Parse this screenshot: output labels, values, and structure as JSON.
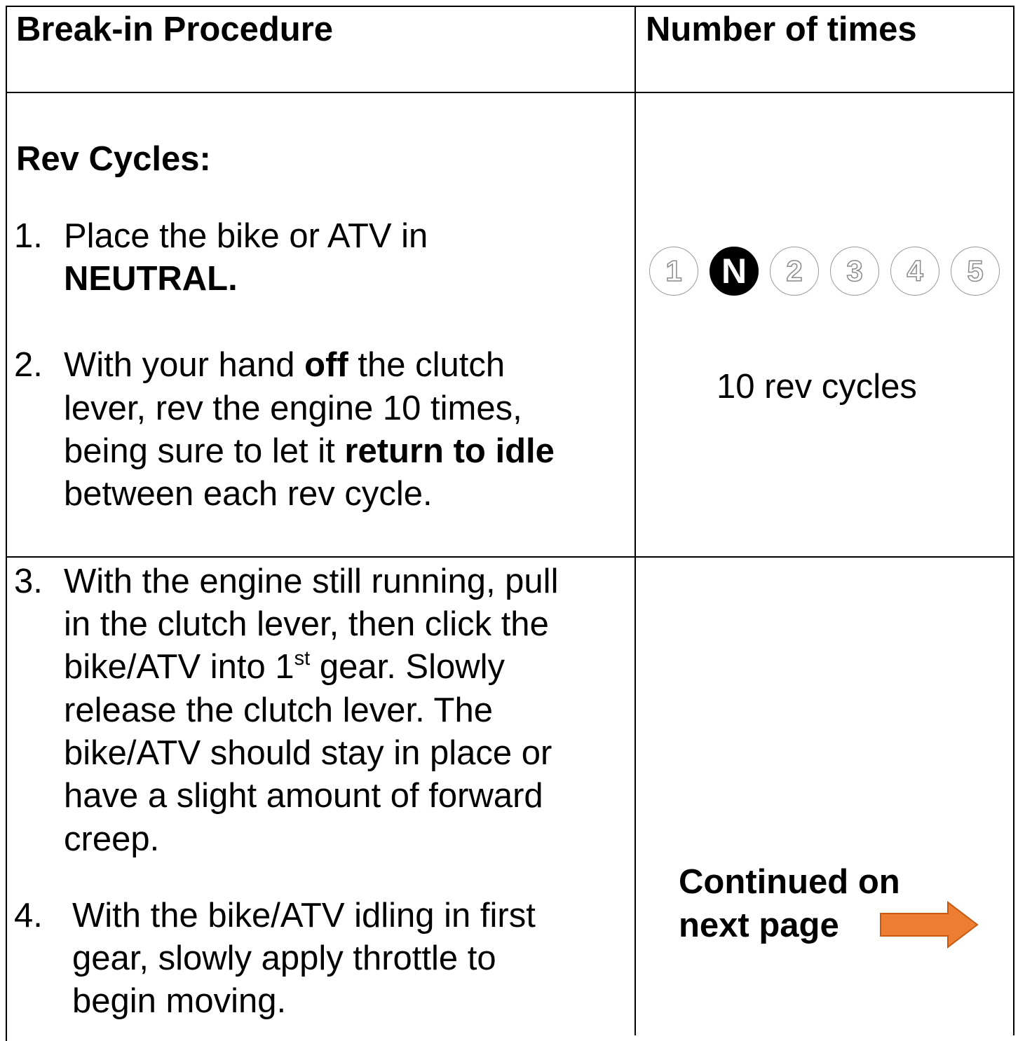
{
  "header": {
    "col1": "Break-in Procedure",
    "col2": "Number of times"
  },
  "section_title": "Rev Cycles:",
  "step1": {
    "num": "1.",
    "line1": "Place the bike or ATV in",
    "bold": "NEUTRAL."
  },
  "step2": {
    "num": "2.",
    "l1_a": "With your hand ",
    "l1_bold": "off",
    "l1_b": " the clutch",
    "l2": "lever, rev the engine 10 times,",
    "l3_a": "being sure to let it ",
    "l3_bold": "return to idle",
    "l4": "between each rev cycle."
  },
  "gears": {
    "labels": [
      "1",
      "N",
      "2",
      "3",
      "4",
      "5"
    ],
    "selected": "N"
  },
  "rev_count": "10 rev cycles",
  "step3": {
    "num": "3.",
    "l1": "With the engine still running, pull",
    "l2": "in the clutch lever, then click the",
    "l3_a": "bike/ATV into 1",
    "l3_sup": "st",
    "l3_b": " gear. Slowly",
    "l4": "release the clutch lever. The",
    "l5": "bike/ATV should stay in place or",
    "l6": "have a slight amount of forward",
    "l7": "creep."
  },
  "step4": {
    "num": "4.",
    "l1": "With the bike/ATV idling in first",
    "l2": "gear, slowly apply throttle to",
    "l3": "begin moving."
  },
  "continued": {
    "line1": "Continued on",
    "line2": "next page"
  },
  "arrow_color": "#ED7D31",
  "arrow_stroke": "#C55A11",
  "arrow_icon": "right-arrow-icon"
}
